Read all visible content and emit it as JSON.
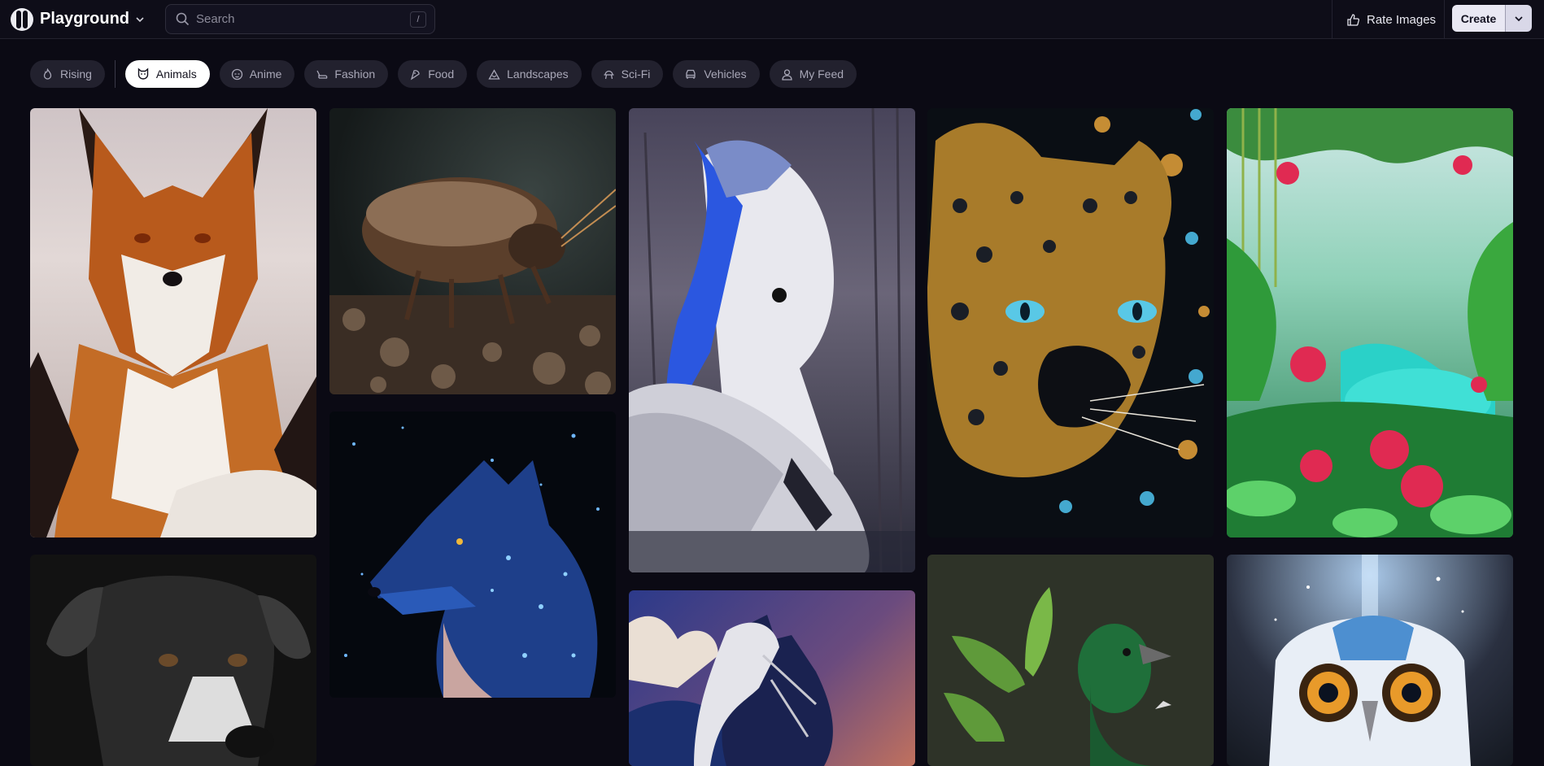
{
  "header": {
    "app_name": "Playground",
    "search_placeholder": "Search",
    "search_shortcut": "/",
    "rate_label": "Rate Images",
    "create_label": "Create"
  },
  "categories": [
    {
      "label": "Rising",
      "icon": "flame-icon",
      "active": false
    },
    {
      "label": "Animals",
      "icon": "cat-face-icon",
      "active": true
    },
    {
      "label": "Anime",
      "icon": "anime-face-icon",
      "active": false
    },
    {
      "label": "Fashion",
      "icon": "heel-icon",
      "active": false
    },
    {
      "label": "Food",
      "icon": "food-icon",
      "active": false
    },
    {
      "label": "Landscapes",
      "icon": "mountain-icon",
      "active": false
    },
    {
      "label": "Sci-Fi",
      "icon": "alien-icon",
      "active": false
    },
    {
      "label": "Vehicles",
      "icon": "car-icon",
      "active": false
    },
    {
      "label": "My Feed",
      "icon": "user-icon",
      "active": false
    }
  ],
  "gallery": [
    {
      "subject": "fox"
    },
    {
      "subject": "beetle"
    },
    {
      "subject": "swan"
    },
    {
      "subject": "jeweled leopard"
    },
    {
      "subject": "jungle"
    },
    {
      "subject": "dog"
    },
    {
      "subject": "wolf"
    },
    {
      "subject": "horse"
    },
    {
      "subject": "green bird"
    },
    {
      "subject": "owl"
    }
  ],
  "colors": {
    "background": "#0b0a14",
    "chip_bg": "#22212e",
    "chip_active_bg": "#ffffff",
    "create_bg": "#e9e8f3"
  }
}
